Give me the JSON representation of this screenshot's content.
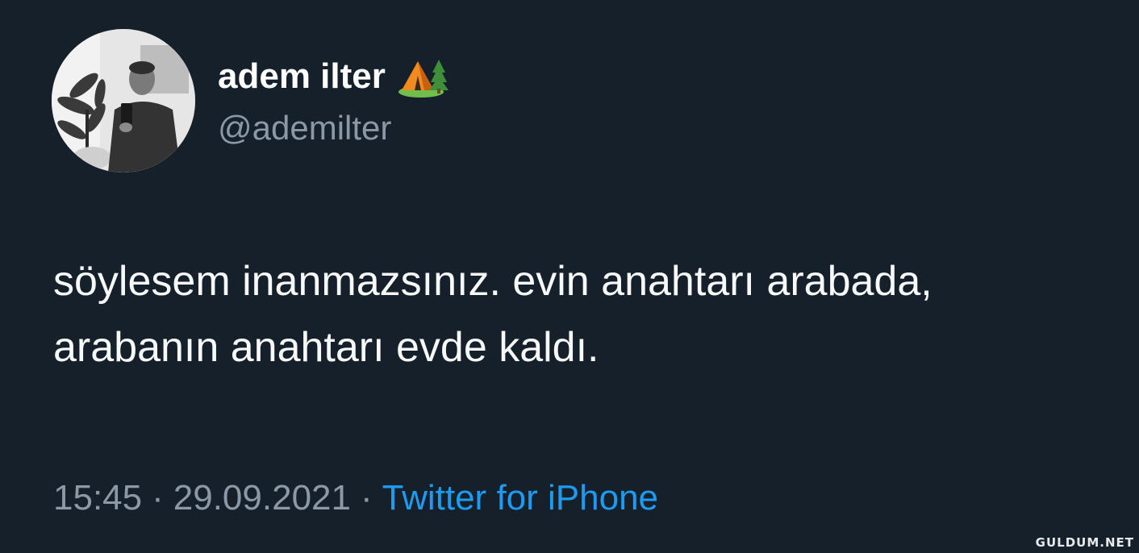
{
  "tweet": {
    "author_name": "adem ilter",
    "author_emoji_icon": "camping-tent-icon",
    "author_handle": "@ademilter",
    "text": "söylesem inanmazsınız. evin anahtarı arabada, arabanın anahtarı evde kaldı.",
    "time": "15:45",
    "date": "29.09.2021",
    "separator": "·",
    "source": "Twitter for iPhone"
  },
  "watermark": "GULDUM.NET",
  "colors": {
    "background": "#15202b",
    "text": "#f7f9f9",
    "secondary": "#8b98a5",
    "link": "#1d9bf0"
  }
}
